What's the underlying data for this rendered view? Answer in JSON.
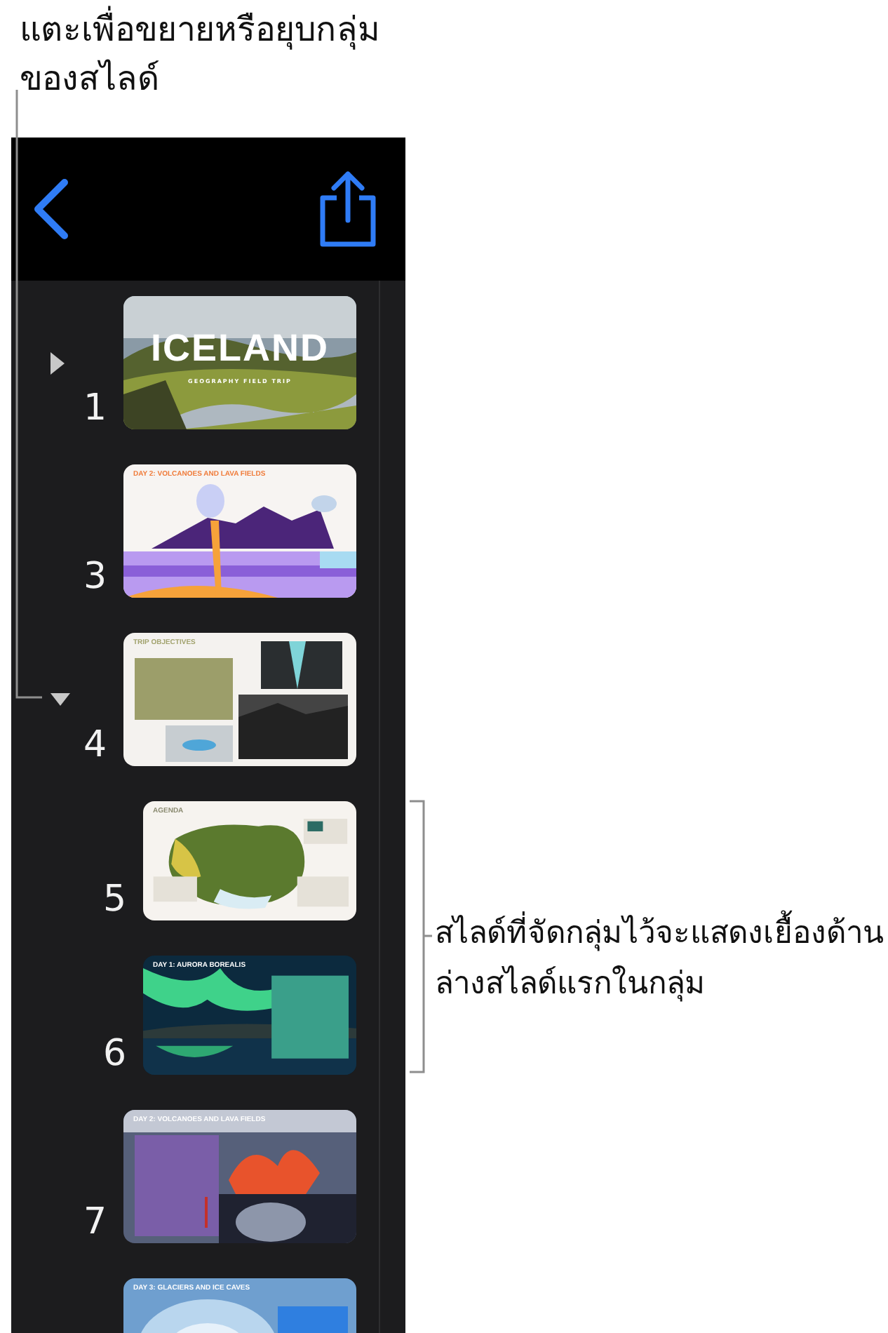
{
  "callouts": [
    {
      "text": "แตะเพื่อขยายหรือยุบกลุ่มของสไลด์"
    },
    {
      "text": "สไลด์ที่จัดกลุ่มไว้จะแสดงเยื้องด้านล่างสไลด์แรกในกลุ่ม"
    }
  ],
  "navigator": {
    "slides": [
      {
        "number": "1",
        "title": "ICELAND",
        "subtitle": "GEOGRAPHY FIELD TRIP",
        "expanded": false
      },
      {
        "number": "3",
        "title": "DAY 2: VOLCANOES AND LAVA FIELDS"
      },
      {
        "number": "4",
        "title": "TRIP OBJECTIVES",
        "expanded": true,
        "children": [
          {
            "number": "5",
            "title": "AGENDA"
          },
          {
            "number": "6",
            "title": "DAY 1: AURORA BOREALIS"
          }
        ]
      },
      {
        "number": "7",
        "title": "DAY 2: VOLCANOES AND LAVA FIELDS"
      },
      {
        "title": "DAY 3: GLACIERS AND ICE CAVES"
      }
    ]
  }
}
